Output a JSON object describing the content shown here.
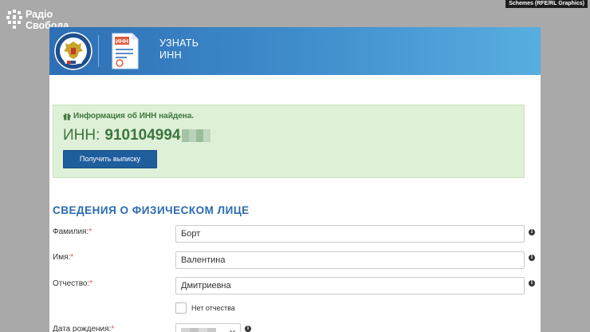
{
  "watermark": {
    "name_line1": "Радіо",
    "name_line2": "Свобода"
  },
  "credit": "Schemes (RFE/RL Graphics)",
  "header": {
    "title_line1": "УЗНАТЬ",
    "title_line2": "ИНН",
    "icon_badge": "ИНН"
  },
  "result": {
    "message": "Информация об ИНН найдена.",
    "inn_label": "ИНН:",
    "inn_value": "910104994",
    "button_label": "Получить выписку"
  },
  "section": {
    "title": "СВЕДЕНИЯ О ФИЗИЧЕСКОМ ЛИЦЕ"
  },
  "form": {
    "surname": {
      "label": "Фамилия:",
      "required_mark": "*",
      "value": "Борт"
    },
    "name": {
      "label": "Имя:",
      "required_mark": "*",
      "value": "Валентина"
    },
    "patronymic": {
      "label": "Отчество:",
      "required_mark": "*",
      "value": "Дмитриевна"
    },
    "no_patronymic": {
      "label": "Нет отчества",
      "checked": false
    },
    "birth_date": {
      "label": "Дата рождения:",
      "required_mark": "*"
    },
    "info_glyph": "i"
  },
  "colors": {
    "page_bg": "#a9a9a9",
    "header_gradient_start": "#2d6fb5",
    "header_gradient_end": "#58aee0",
    "alert_bg": "#dff0d8",
    "alert_text": "#3c763d",
    "button_bg": "#1e5e9d",
    "section_title": "#2b6bb0",
    "required": "#d9534f"
  }
}
